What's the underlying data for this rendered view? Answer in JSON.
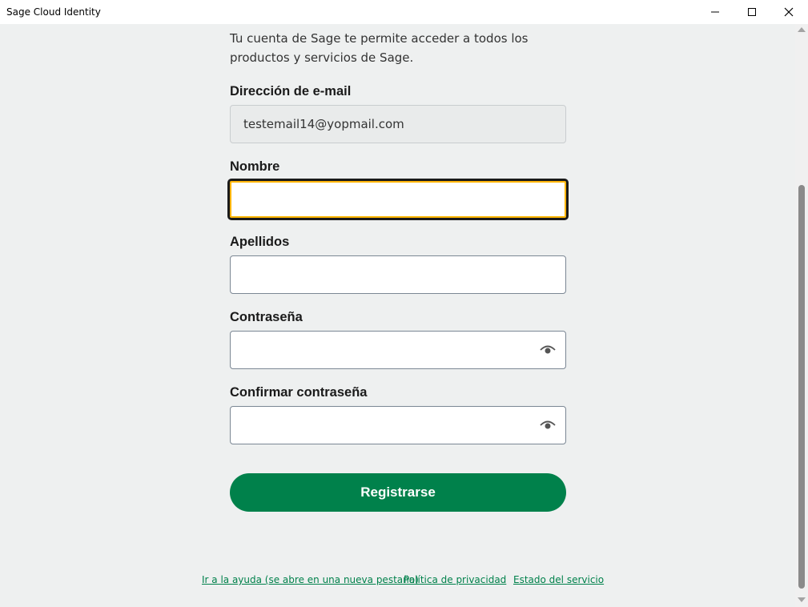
{
  "window": {
    "title": "Sage Cloud Identity",
    "minimize_icon": "minimize-icon",
    "maximize_icon": "maximize-icon",
    "close_icon": "close-icon"
  },
  "form": {
    "intro": "Tu cuenta de Sage te permite acceder a todos los productos y servicios de Sage.",
    "email": {
      "label": "Dirección de e-mail",
      "value": "testemail14@yopmail.com"
    },
    "first_name": {
      "label": "Nombre",
      "value": ""
    },
    "last_name": {
      "label": "Apellidos",
      "value": ""
    },
    "password": {
      "label": "Contraseña",
      "value": "",
      "icon": "eye-icon"
    },
    "confirm_password": {
      "label": "Confirmar contraseña",
      "value": "",
      "icon": "eye-icon"
    },
    "submit_label": "Registrarse"
  },
  "footer": {
    "links": [
      "Ir a la ayuda (se abre en una nueva pestaña)",
      "Política de privacidad",
      "Estado del servicio"
    ]
  },
  "colors": {
    "primary": "#00814b",
    "focus_ring": "#ffb500",
    "background": "#eef0f0"
  }
}
